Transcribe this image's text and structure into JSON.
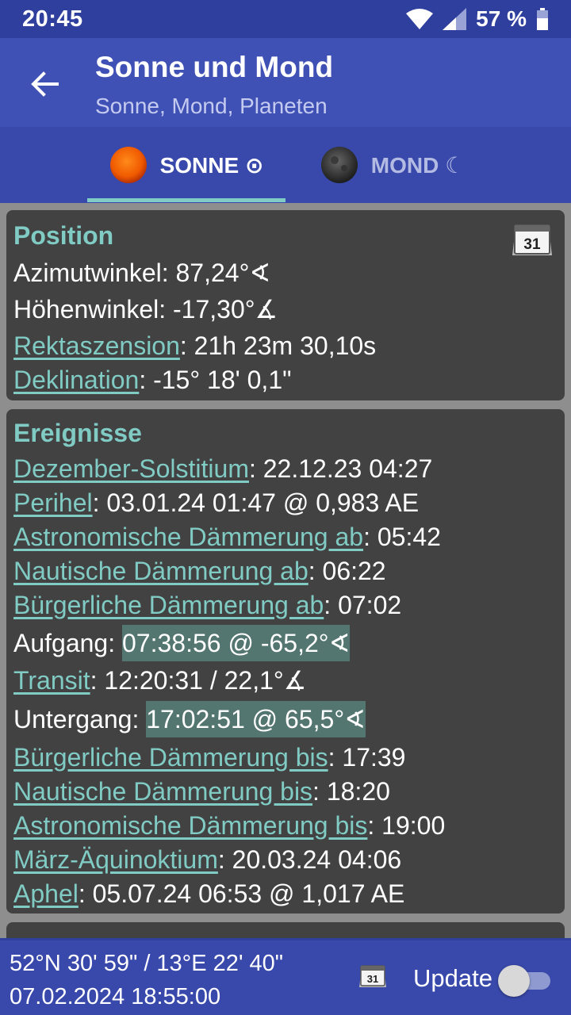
{
  "status_bar": {
    "time": "20:45",
    "battery_text": "57 %"
  },
  "app_bar": {
    "title": "Sonne und Mond",
    "subtitle": "Sonne, Mond, Planeten"
  },
  "tabs": [
    {
      "label": "SONNE ⊙",
      "icon": "sun-icon",
      "selected": true
    },
    {
      "label": "MOND ☾",
      "icon": "moon-icon",
      "selected": false
    }
  ],
  "position": {
    "heading": "Position",
    "calendar_icon_text": "31",
    "rows": [
      {
        "label": "Azimutwinkel",
        "value": ": 87,24°∢"
      },
      {
        "label": "Höhenwinkel",
        "value": ": -17,30°∡"
      },
      {
        "label": "Rektaszension",
        "value": ": 21h 23m 30,10s"
      },
      {
        "label": "Deklination",
        "value": ": -15° 18' 0,1\""
      }
    ]
  },
  "events": {
    "heading": "Ereignisse",
    "rows": [
      {
        "label": "Dezember-Solstitium",
        "value": ": 22.12.23 04:27"
      },
      {
        "label": "Perihel",
        "value": ": 03.01.24 01:47 @ 0,983 AE"
      },
      {
        "label": "Astronomische Dämmerung ab",
        "value": ": 05:42"
      },
      {
        "label": "Nautische Dämmerung ab",
        "value": ": 06:22"
      },
      {
        "label": "Bürgerliche Dämmerung ab",
        "value": ": 07:02"
      },
      {
        "label": "Aufgang: ",
        "value": "07:38:56 @ -65,2°∢"
      },
      {
        "label": "Transit",
        "value": ": 12:20:31 / 22,1°∡"
      },
      {
        "label": "Untergang: ",
        "value": "17:02:51 @ 65,5°∢"
      },
      {
        "label": "Bürgerliche Dämmerung bis",
        "value": ": 17:39"
      },
      {
        "label": "Nautische Dämmerung bis",
        "value": ": 18:20"
      },
      {
        "label": "Astronomische Dämmerung bis",
        "value": ": 19:00"
      },
      {
        "label": "März-Äquinoktium",
        "value": ": 20.03.24 04:06"
      },
      {
        "label": "Aphel",
        "value": ": 05.07.24 06:53 @ 1,017 AE"
      }
    ]
  },
  "bottom_bar": {
    "coordinates": "52°N 30' 59\" / 13°E 22' 40\"",
    "datetime": "07.02.2024 18:55:00",
    "calendar_icon_text": "31",
    "update_label": "Update",
    "update_on": false
  },
  "colors": {
    "accent": "#80cbc4",
    "primary": "#3f51b5",
    "card": "#424242",
    "highlight": "#547671"
  }
}
